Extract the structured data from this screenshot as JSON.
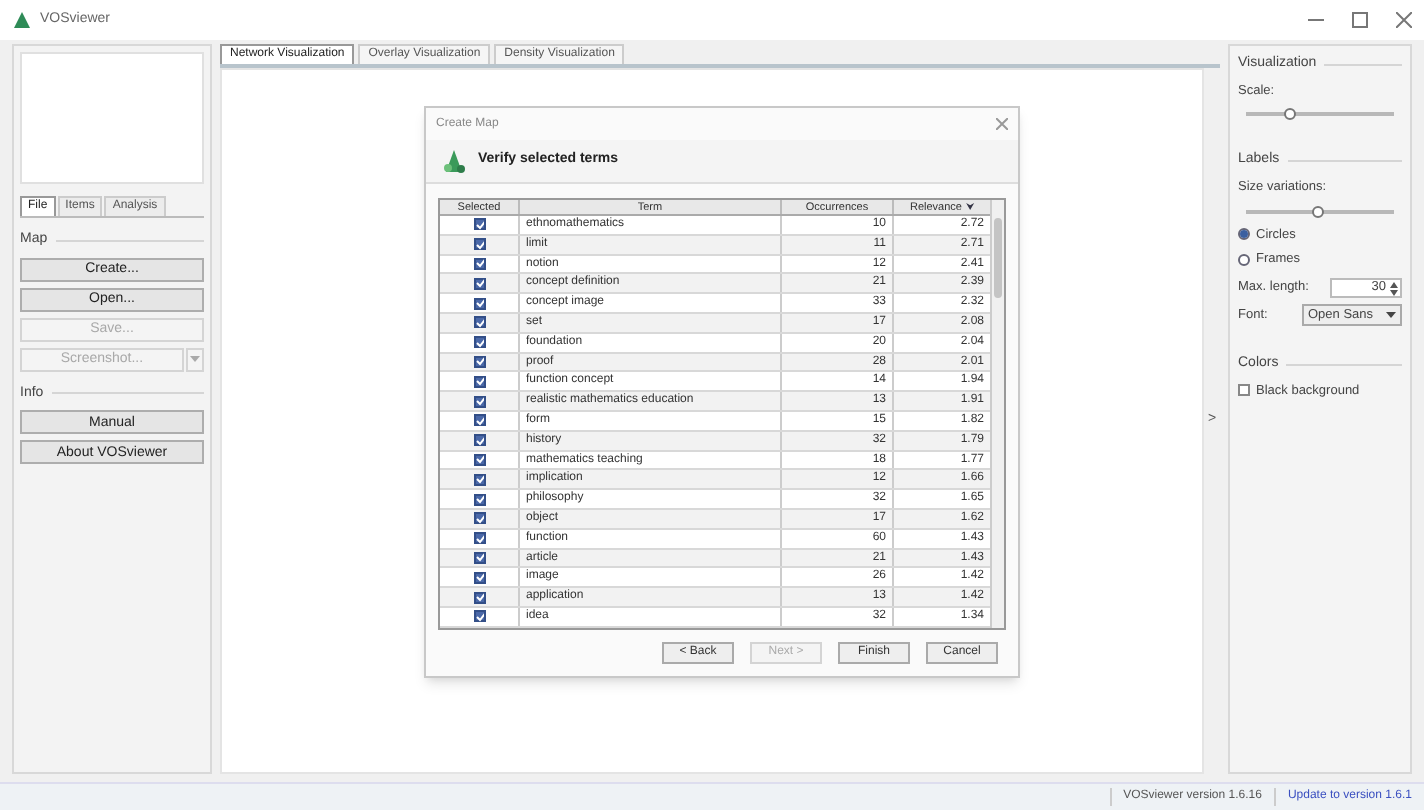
{
  "window": {
    "title": "VOSviewer"
  },
  "left_panel": {
    "tabs": [
      {
        "label": "File",
        "selected": true
      },
      {
        "label": "Items",
        "selected": false
      },
      {
        "label": "Analysis",
        "selected": false
      }
    ],
    "map_section": {
      "title": "Map",
      "buttons": [
        {
          "label": "Create...",
          "disabled": false
        },
        {
          "label": "Open...",
          "disabled": false
        },
        {
          "label": "Save...",
          "disabled": true
        }
      ],
      "screenshot_button": {
        "label": "Screenshot...",
        "disabled": true
      }
    },
    "info_section": {
      "title": "Info",
      "buttons": [
        {
          "label": "Manual",
          "disabled": false
        },
        {
          "label": "About VOSviewer",
          "disabled": false
        }
      ]
    }
  },
  "view_tabs": [
    {
      "label": "Network Visualization",
      "selected": true
    },
    {
      "label": "Overlay Visualization",
      "selected": false
    },
    {
      "label": "Density Visualization",
      "selected": false
    }
  ],
  "dialog": {
    "title": "Create Map",
    "heading": "Verify selected terms",
    "table": {
      "columns": [
        "Selected",
        "Term",
        "Occurrences",
        "Relevance"
      ],
      "sort_indicator": "⮟",
      "rows": [
        {
          "checked": true,
          "term": "ethnomathematics",
          "occurrences": "10",
          "relevance": "2.72"
        },
        {
          "checked": true,
          "term": "limit",
          "occurrences": "11",
          "relevance": "2.71"
        },
        {
          "checked": true,
          "term": "notion",
          "occurrences": "12",
          "relevance": "2.41"
        },
        {
          "checked": true,
          "term": "concept definition",
          "occurrences": "21",
          "relevance": "2.39"
        },
        {
          "checked": true,
          "term": "concept image",
          "occurrences": "33",
          "relevance": "2.32"
        },
        {
          "checked": true,
          "term": "set",
          "occurrences": "17",
          "relevance": "2.08"
        },
        {
          "checked": true,
          "term": "foundation",
          "occurrences": "20",
          "relevance": "2.04"
        },
        {
          "checked": true,
          "term": "proof",
          "occurrences": "28",
          "relevance": "2.01"
        },
        {
          "checked": true,
          "term": "function concept",
          "occurrences": "14",
          "relevance": "1.94"
        },
        {
          "checked": true,
          "term": "realistic mathematics education",
          "occurrences": "13",
          "relevance": "1.91"
        },
        {
          "checked": true,
          "term": "form",
          "occurrences": "15",
          "relevance": "1.82"
        },
        {
          "checked": true,
          "term": "history",
          "occurrences": "32",
          "relevance": "1.79"
        },
        {
          "checked": true,
          "term": "mathematics teaching",
          "occurrences": "18",
          "relevance": "1.77"
        },
        {
          "checked": true,
          "term": "implication",
          "occurrences": "12",
          "relevance": "1.66"
        },
        {
          "checked": true,
          "term": "philosophy",
          "occurrences": "32",
          "relevance": "1.65"
        },
        {
          "checked": true,
          "term": "object",
          "occurrences": "17",
          "relevance": "1.62"
        },
        {
          "checked": true,
          "term": "function",
          "occurrences": "60",
          "relevance": "1.43"
        },
        {
          "checked": true,
          "term": "article",
          "occurrences": "21",
          "relevance": "1.43"
        },
        {
          "checked": true,
          "term": "image",
          "occurrences": "26",
          "relevance": "1.42"
        },
        {
          "checked": true,
          "term": "application",
          "occurrences": "13",
          "relevance": "1.42"
        },
        {
          "checked": true,
          "term": "idea",
          "occurrences": "32",
          "relevance": "1.34"
        }
      ]
    },
    "buttons": [
      {
        "label": "< Back",
        "disabled": false
      },
      {
        "label": "Next >",
        "disabled": true
      },
      {
        "label": "Finish",
        "disabled": false
      },
      {
        "label": "Cancel",
        "disabled": false
      }
    ]
  },
  "collapse_arrow": ">",
  "right_panel": {
    "visualization": {
      "title": "Visualization",
      "scale_label": "Scale:",
      "scale": {
        "level": 0.3
      }
    },
    "labels": {
      "title": "Labels",
      "size_label": "Size variations:",
      "size": {
        "level": 0.48
      },
      "options": [
        {
          "label": "Circles",
          "selected": true
        },
        {
          "label": "Frames",
          "selected": false
        }
      ],
      "max_length_label": "Max. length:",
      "max_length": "30",
      "font_label": "Font:",
      "font": "Open Sans"
    },
    "colors": {
      "title": "Colors",
      "black_background": {
        "label": "Black background",
        "checked": false
      }
    }
  },
  "status_bar": {
    "version": "VOSviewer version 1.6.16",
    "update_link": "Update to version 1.6.1"
  }
}
